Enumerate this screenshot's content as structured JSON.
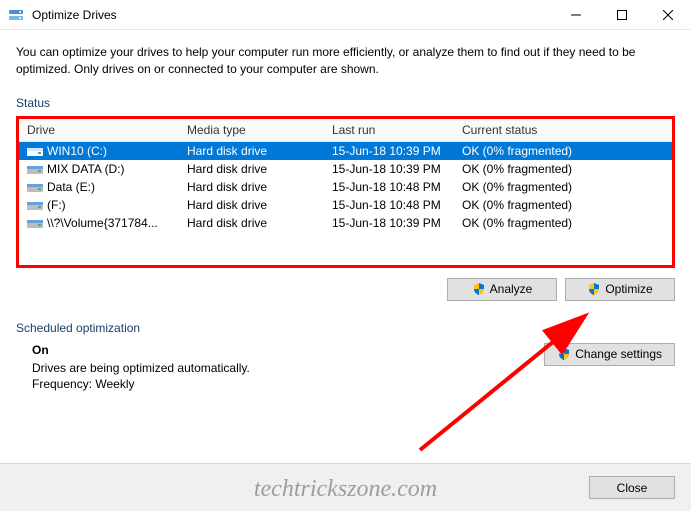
{
  "window": {
    "title": "Optimize Drives"
  },
  "description": "You can optimize your drives to help your computer run more efficiently, or analyze them to find out if they need to be optimized. Only drives on or connected to your computer are shown.",
  "status_label": "Status",
  "columns": {
    "drive": "Drive",
    "media": "Media type",
    "last": "Last run",
    "status": "Current status"
  },
  "drives": [
    {
      "name": "WIN10 (C:)",
      "media": "Hard disk drive",
      "last": "15-Jun-18 10:39 PM",
      "status": "OK (0% fragmented)",
      "selected": true
    },
    {
      "name": "MIX DATA (D:)",
      "media": "Hard disk drive",
      "last": "15-Jun-18 10:39 PM",
      "status": "OK (0% fragmented)",
      "selected": false
    },
    {
      "name": "Data (E:)",
      "media": "Hard disk drive",
      "last": "15-Jun-18 10:48 PM",
      "status": "OK (0% fragmented)",
      "selected": false
    },
    {
      "name": "(F:)",
      "media": "Hard disk drive",
      "last": "15-Jun-18 10:48 PM",
      "status": "OK (0% fragmented)",
      "selected": false
    },
    {
      "name": "\\\\?\\Volume{371784...",
      "media": "Hard disk drive",
      "last": "15-Jun-18 10:39 PM",
      "status": "OK (0% fragmented)",
      "selected": false
    }
  ],
  "buttons": {
    "analyze": "Analyze",
    "optimize": "Optimize",
    "change": "Change settings",
    "close": "Close"
  },
  "sched": {
    "header": "Scheduled optimization",
    "on": "On",
    "line1": "Drives are being optimized automatically.",
    "line2": "Frequency: Weekly"
  },
  "watermark": "techtrickszone.com"
}
